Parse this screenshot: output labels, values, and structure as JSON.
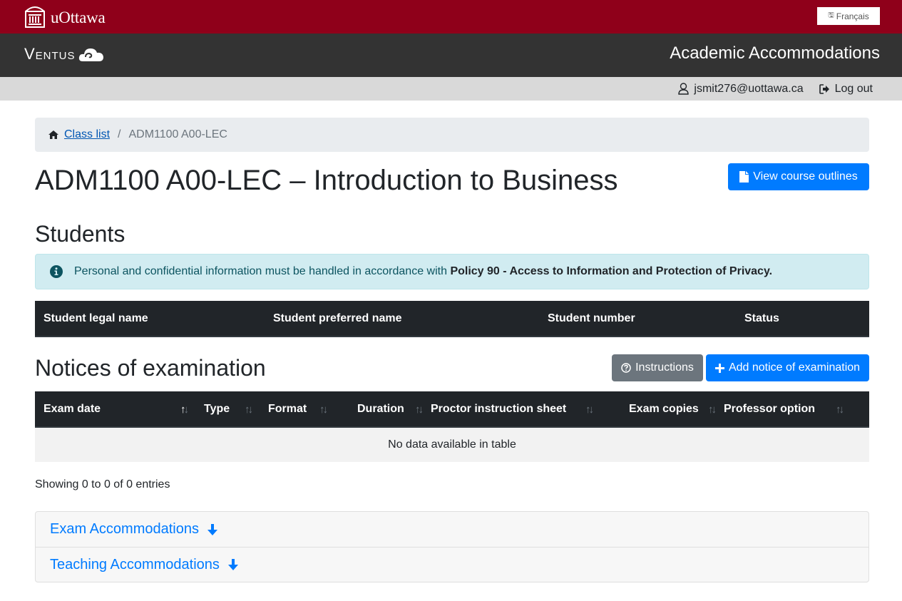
{
  "header": {
    "university_name": "uOttawa",
    "language_button": "Français",
    "app_logo_text": "Ventus",
    "app_title": "Academic Accommodations",
    "user_email": "jsmit276@uottawa.ca",
    "logout_label": "Log out"
  },
  "breadcrumb": {
    "home_label": "Class list",
    "separator": "/",
    "current": "ADM1100 A00-LEC"
  },
  "page": {
    "title": "ADM1100 A00-LEC – Introduction to Business",
    "view_outlines_label": "View course outlines"
  },
  "students": {
    "heading": "Students",
    "alert_text": "Personal and confidential information must be handled in accordance with ",
    "alert_policy": "Policy 90 - Access to Information and Protection of Privacy.",
    "columns": [
      "Student legal name",
      "Student preferred name",
      "Student number",
      "Status"
    ],
    "rows": []
  },
  "notices": {
    "heading": "Notices of examination",
    "instructions_label": "Instructions",
    "add_label": "Add notice of examination",
    "columns": [
      "Exam date",
      "Type",
      "Format",
      "Duration",
      "Proctor instruction sheet",
      "Exam copies",
      "Professor option"
    ],
    "rows": [],
    "empty_message": "No data available in table",
    "info": "Showing 0 to 0 of 0 entries"
  },
  "accordion": [
    {
      "label": "Exam Accommodations",
      "icon": "arrow-down-icon"
    },
    {
      "label": "Teaching Accommodations",
      "icon": "arrow-down-icon"
    }
  ],
  "colors": {
    "brand_red": "#8f001a",
    "app_bar": "#333333",
    "primary": "#007bff",
    "secondary": "#6c757d",
    "table_header": "#212529"
  }
}
